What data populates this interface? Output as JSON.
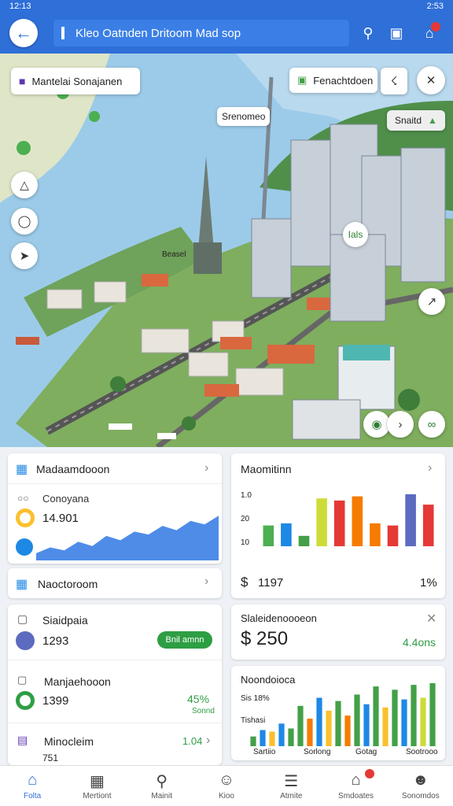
{
  "status_bar": {
    "time": "12:13",
    "right": "2:53"
  },
  "header": {
    "search_text": "Kleo Oatnden Dritoom Mad sop"
  },
  "map": {
    "chip_left": "Mantelai Sonajanen",
    "chip_right": "Fenachtdoen",
    "pin_label": "Srenomeo",
    "tag_right": "Snaitd",
    "tag_mid": "Ials",
    "tag_street": "Beasel"
  },
  "card1": {
    "title": "Madaamdooon",
    "sub": "Conoyana",
    "value": "14.901"
  },
  "card2": {
    "title": "Maomitinn",
    "y_labels": [
      "1.0",
      "20",
      "10"
    ],
    "dollar": "$",
    "value": "1197",
    "pct": "1%"
  },
  "card3": {
    "title": "Naoctoroom"
  },
  "card4": {
    "title": "Siaidpaia",
    "value": "1293",
    "button": "Bnil amnn"
  },
  "card5": {
    "title": "Slaleidenoooeon",
    "amount": "$ 250",
    "delta": "4.4ons"
  },
  "card6": {
    "title": "Manjaehooon",
    "value": "1399",
    "pct": "45%",
    "sub": "Sonnd"
  },
  "card7": {
    "title": "Noondoioca",
    "sub": "Sis 18%",
    "tline": "Tishasi",
    "x_labels": [
      "Sartiio",
      "Sorlong",
      "Gotag",
      "Sootrooo"
    ]
  },
  "card8": {
    "title": "Minocleim",
    "value": "1.04",
    "bottom": "751"
  },
  "nav": [
    {
      "label": "Folta",
      "icon": "home-icon"
    },
    {
      "label": "Mertiont",
      "icon": "grid-icon"
    },
    {
      "label": "Mainit",
      "icon": "search-icon"
    },
    {
      "label": "Kioo",
      "icon": "face-icon"
    },
    {
      "label": "Atmite",
      "icon": "list-icon"
    },
    {
      "label": "Smdoates",
      "icon": "store-icon"
    },
    {
      "label": "Sonomdos",
      "icon": "person-icon"
    }
  ],
  "chart_data": [
    {
      "type": "area",
      "title": "Madaamdooon",
      "values": [
        10,
        18,
        14,
        26,
        20,
        34,
        28,
        40,
        36,
        48,
        42,
        55,
        50,
        62
      ],
      "color": "#3b7fe6"
    },
    {
      "type": "bar",
      "title": "Maomitinn",
      "values": [
        20,
        22,
        10,
        46,
        44,
        48,
        22,
        20,
        50,
        40
      ],
      "colors": [
        "#4caf50",
        "#1e88e5",
        "#43a047",
        "#cddc39",
        "#e53935",
        "#f57c00",
        "#f57c00",
        "#e53935",
        "#5c6bc0",
        "#e53935"
      ]
    },
    {
      "type": "bar",
      "title": "Noondoioca",
      "values": [
        12,
        20,
        18,
        28,
        22,
        50,
        34,
        60,
        44,
        56,
        38,
        64,
        52,
        74,
        48,
        70,
        58,
        76,
        60,
        78
      ],
      "colors": [
        "#43a047",
        "#1e88e5",
        "#fbc02d",
        "#1e88e5",
        "#43a047",
        "#43a047",
        "#f57c00",
        "#1e88e5",
        "#fbc02d",
        "#43a047",
        "#f57c00",
        "#43a047",
        "#1e88e5",
        "#43a047",
        "#fbc02d",
        "#43a047",
        "#1e88e5",
        "#43a047",
        "#cddc39",
        "#43a047"
      ]
    }
  ]
}
